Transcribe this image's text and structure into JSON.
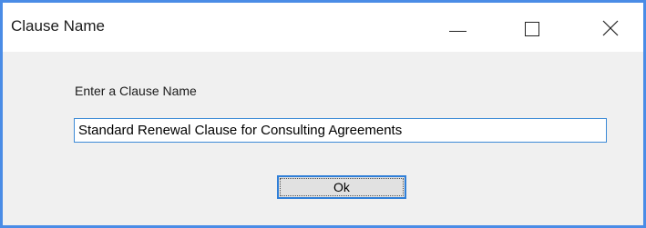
{
  "window": {
    "title": "Clause Name",
    "accent_color": "#4a8ce6",
    "controls": {
      "minimize_icon": "minimize-icon",
      "maximize_icon": "maximize-icon",
      "close_icon": "close-icon"
    }
  },
  "dialog": {
    "prompt": "Enter a Clause Name",
    "clause_name_value": "Standard Renewal Clause for Consulting Agreements",
    "ok_label": "Ok"
  }
}
